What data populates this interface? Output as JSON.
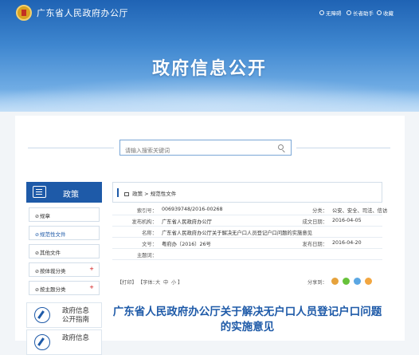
{
  "site": {
    "title": "广东省人民政府办公厅"
  },
  "top_links": [
    {
      "icon": "accessibility-icon",
      "label": "无障碍"
    },
    {
      "icon": "elder-help-icon",
      "label": "长者助手"
    },
    {
      "icon": "star-icon",
      "label": "收藏"
    }
  ],
  "banner": {
    "title": "政府信息公开"
  },
  "search": {
    "placeholder": "请输入搜索关键词",
    "value": ""
  },
  "sidebar": {
    "header": "政策",
    "items": [
      {
        "label": "规章",
        "active": false,
        "expand": ""
      },
      {
        "label": "规范性文件",
        "active": true,
        "expand": ""
      },
      {
        "label": "其他文件",
        "active": false,
        "expand": ""
      },
      {
        "label": "按体裁分类",
        "active": false,
        "expand": "+"
      },
      {
        "label": "按主题分类",
        "active": false,
        "expand": "+"
      }
    ],
    "cards": [
      {
        "line1": "政府信息",
        "line2": "公开指南"
      },
      {
        "line1": "政府信息",
        "line2": ""
      }
    ]
  },
  "breadcrumb": {
    "items": [
      "政策",
      "规范性文件"
    ],
    "separator": ">"
  },
  "meta": {
    "index_label": "索引号：",
    "index_value": "006939748/2016-00268",
    "category_label": "分类：",
    "category_value": "公安、安全、司法、信访",
    "publisher_label": "发布机构：",
    "publisher_value": "广东省人民政府办公厅",
    "created_label": "成文日期：",
    "created_value": "2016-04-05",
    "name_label": "名称：",
    "name_value": "广东省人民政府办公厅关于解决无户口人员登记户口问题的实施意见",
    "docno_label": "文号：",
    "docno_value": "粤府办〔2016〕26号",
    "pubdate_label": "发布日期：",
    "pubdate_value": "2016-04-20",
    "keywords_label": "主题词：",
    "keywords_value": ""
  },
  "toolbar": {
    "print": "【打印】",
    "font_size_prefix": "【字体：",
    "font_sizes": [
      "大",
      "中",
      "小"
    ],
    "font_size_suffix": "】",
    "share_label": "分享到："
  },
  "share_icons": [
    {
      "name": "share-weibo-icon",
      "color": "#e6a23c"
    },
    {
      "name": "share-wechat-icon",
      "color": "#67c23a"
    },
    {
      "name": "share-qq-icon",
      "color": "#5ba7e3"
    },
    {
      "name": "share-qzone-icon",
      "color": "#f2a640"
    }
  ],
  "article": {
    "title": "广东省人民政府办公厅关于解决无户口人员登记户口问题的实施意见"
  }
}
